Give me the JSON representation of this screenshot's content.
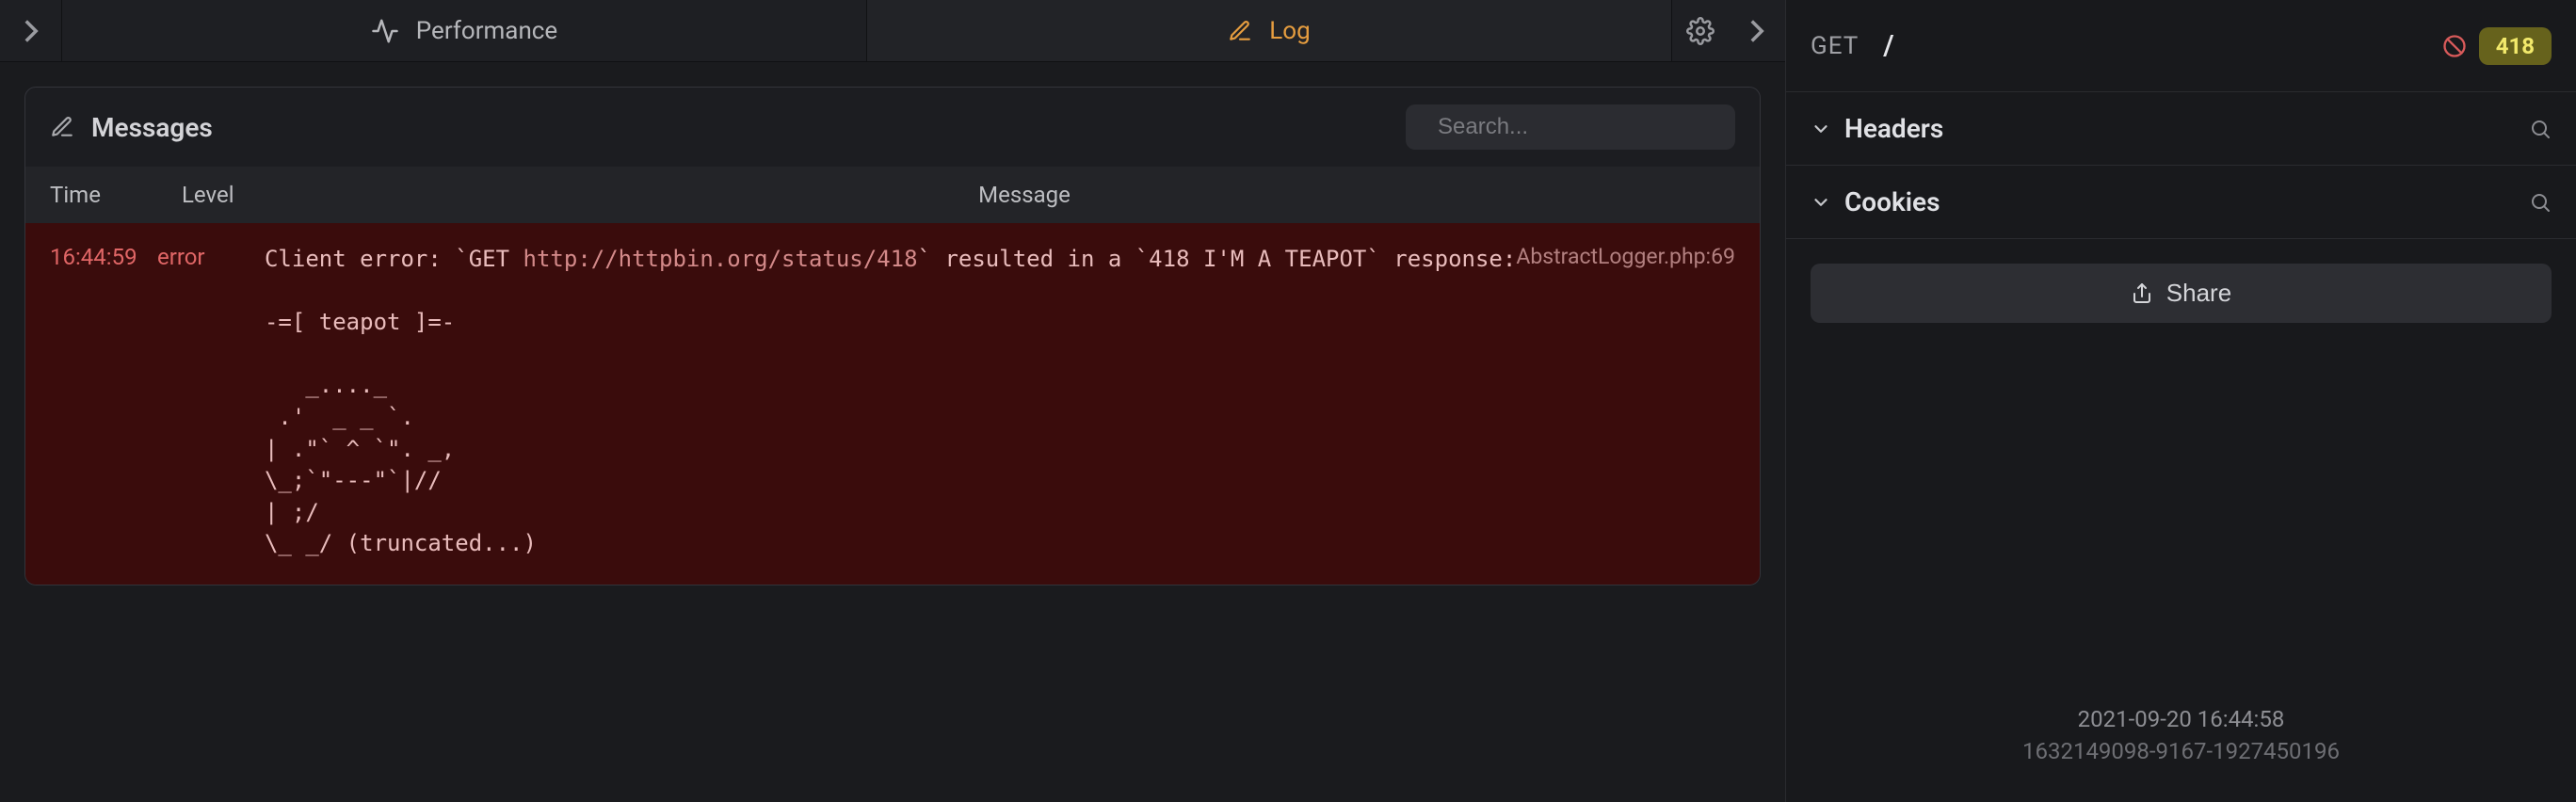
{
  "tabs": {
    "performance": "Performance",
    "log": "Log"
  },
  "messages": {
    "title": "Messages",
    "search_placeholder": "Search...",
    "columns": {
      "time": "Time",
      "level": "Level",
      "message": "Message"
    },
    "rows": [
      {
        "time": "16:44:59",
        "level": "error",
        "source": "AbstractLogger.php:69",
        "body_prefix": "Client error: `GET ",
        "body_url": "http://httpbin.org/status/418",
        "body_suffix": "` resulted in a `418 I'M A TEAPOT` response:\n\n-=[ teapot ]=-\n\n   _...._\n .'  _ _ `.\n| .\"` ^ `\". _,\n\\_;`\"---\"`|//\n| ;/\n\\_ _/ (truncated...)"
      }
    ]
  },
  "side": {
    "method": "GET",
    "path": "/",
    "status": "418",
    "sections": {
      "headers": "Headers",
      "cookies": "Cookies"
    },
    "share": "Share",
    "timestamp": "2021-09-20 16:44:58",
    "request_id": "1632149098-9167-1927450196"
  }
}
